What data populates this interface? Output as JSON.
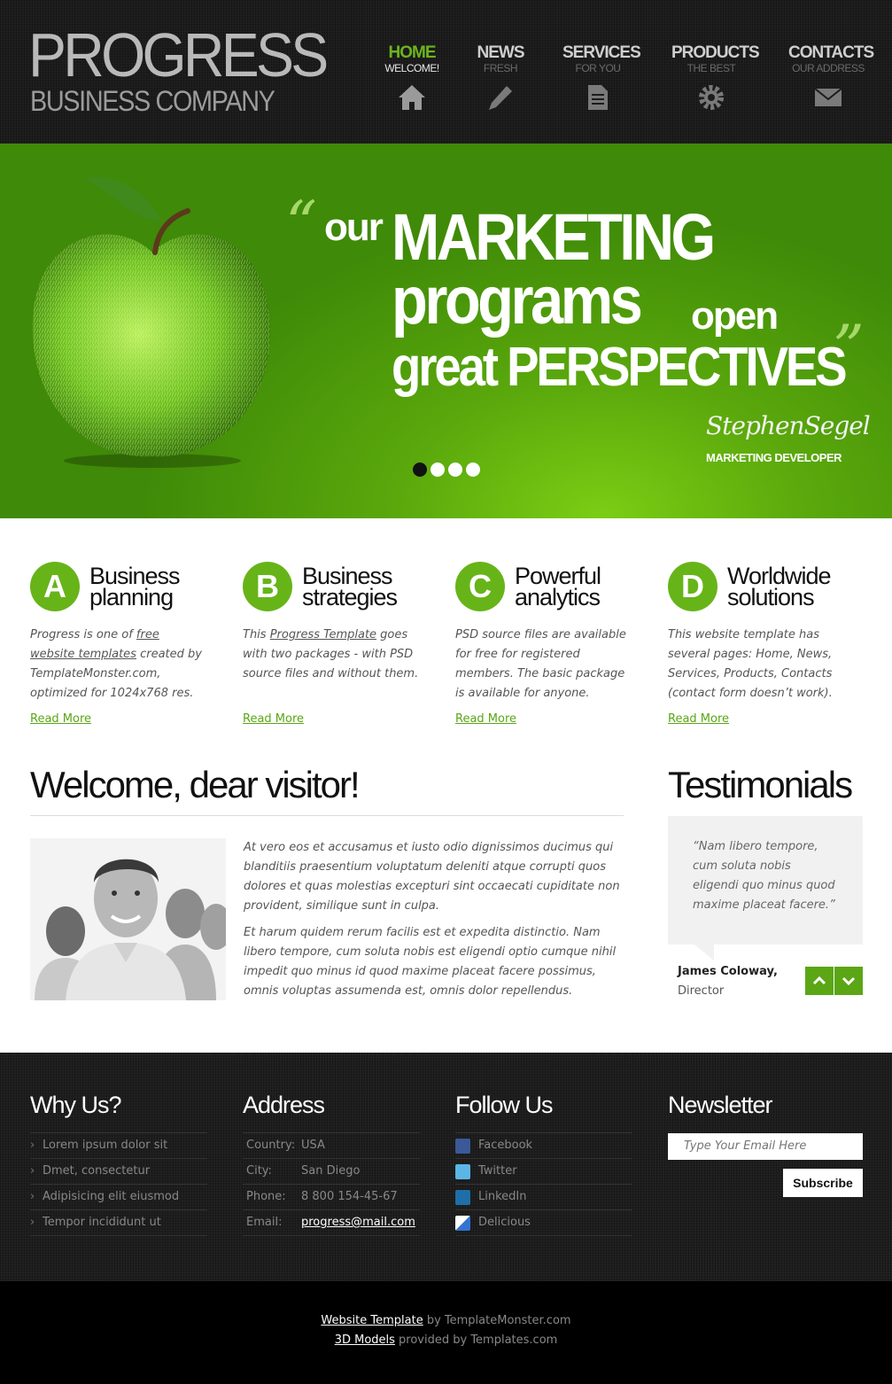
{
  "logo": {
    "title": "PROGRESS",
    "subtitle": "BUSINESS COMPANY"
  },
  "nav": [
    {
      "title": "HOME",
      "sub": "WELCOME!",
      "icon": "home-icon"
    },
    {
      "title": "NEWS",
      "sub": "FRESH",
      "icon": "pencil-icon"
    },
    {
      "title": "SERVICES",
      "sub": "FOR YOU",
      "icon": "document-icon"
    },
    {
      "title": "PRODUCTS",
      "sub": "THE BEST",
      "icon": "gear-icon"
    },
    {
      "title": "CONTACTS",
      "sub": "OUR ADDRESS",
      "icon": "envelope-icon"
    }
  ],
  "banner": {
    "open_quote": "“",
    "close_quote": "”",
    "line_our": "our",
    "line_marketing": "MARKETING",
    "line_programs": "programs",
    "line_open": "open",
    "line_great": "great PERSPECTIVES",
    "signature": "StephenSegel",
    "role": "MARKETING DEVELOPER"
  },
  "features": [
    {
      "letter": "A",
      "title1": "Business",
      "title2": "planning",
      "text_pre": "Progress is one of ",
      "link": "free website templates",
      "text_post": " created by TemplateMonster.com, optimized for 1024x768 res.",
      "more": "Read More"
    },
    {
      "letter": "B",
      "title1": "Business",
      "title2": "strategies",
      "text_pre": "This ",
      "link": "Progress Template",
      "text_post": " goes with two packages - with PSD source files and without them.",
      "more": "Read More"
    },
    {
      "letter": "C",
      "title1": "Powerful",
      "title2": "analytics",
      "text_pre": "PSD source files are available for free for registered members. The basic package is available for anyone.",
      "link": "",
      "text_post": "",
      "more": "Read More"
    },
    {
      "letter": "D",
      "title1": "Worldwide",
      "title2": "solutions",
      "text_pre": "This website template has several pages: Home, News, Services, Products, Contacts (contact form doesn’t work).",
      "link": "",
      "text_post": "",
      "more": "Read More"
    }
  ],
  "welcome": {
    "title": "Welcome, dear visitor!",
    "p1": "At vero eos et accusamus et iusto odio dignissimos ducimus qui blanditiis praesentium voluptatum deleniti atque corrupti quos dolores et quas molestias excepturi sint occaecati cupiditate non provident, similique sunt in culpa.",
    "p2": "Et harum quidem rerum facilis est et expedita distinctio. Nam libero tempore, cum soluta nobis est eligendi optio cumque nihil impedit quo minus id quod maxime placeat facere possimus, omnis voluptas assumenda est, omnis dolor repellendus."
  },
  "testimonials": {
    "title": "Testimonials",
    "quote": "“Nam libero tempore, cum soluta nobis eligendi quo minus quod maxime placeat facere.”",
    "name": "James Coloway,",
    "role": "Director"
  },
  "footer": {
    "why": {
      "title": "Why Us?",
      "items": [
        "Lorem ipsum dolor sit",
        "Dmet, consectetur",
        "Adipisicing elit eiusmod",
        "Tempor incididunt ut"
      ]
    },
    "address": {
      "title": "Address",
      "rows": [
        {
          "k": "Country:",
          "v": "USA"
        },
        {
          "k": "City:",
          "v": "San Diego"
        },
        {
          "k": "Phone:",
          "v": "8 800 154-45-67"
        },
        {
          "k": "Email:",
          "v": "progress@mail.com"
        }
      ]
    },
    "follow": {
      "title": "Follow Us",
      "items": [
        "Facebook",
        "Twitter",
        "LinkedIn",
        "Delicious"
      ]
    },
    "newsletter": {
      "title": "Newsletter",
      "placeholder": "Type Your Email Here",
      "button": "Subscribe"
    }
  },
  "credits": {
    "line1_link": "Website Template",
    "line1_text": " by TemplateMonster.com",
    "line2_link": "3D Models",
    "line2_text": " provided by Templates.com"
  },
  "colors": {
    "accent": "#67b419",
    "header_bg": "#1c1c1c",
    "banner_green": "#5aa80c"
  }
}
